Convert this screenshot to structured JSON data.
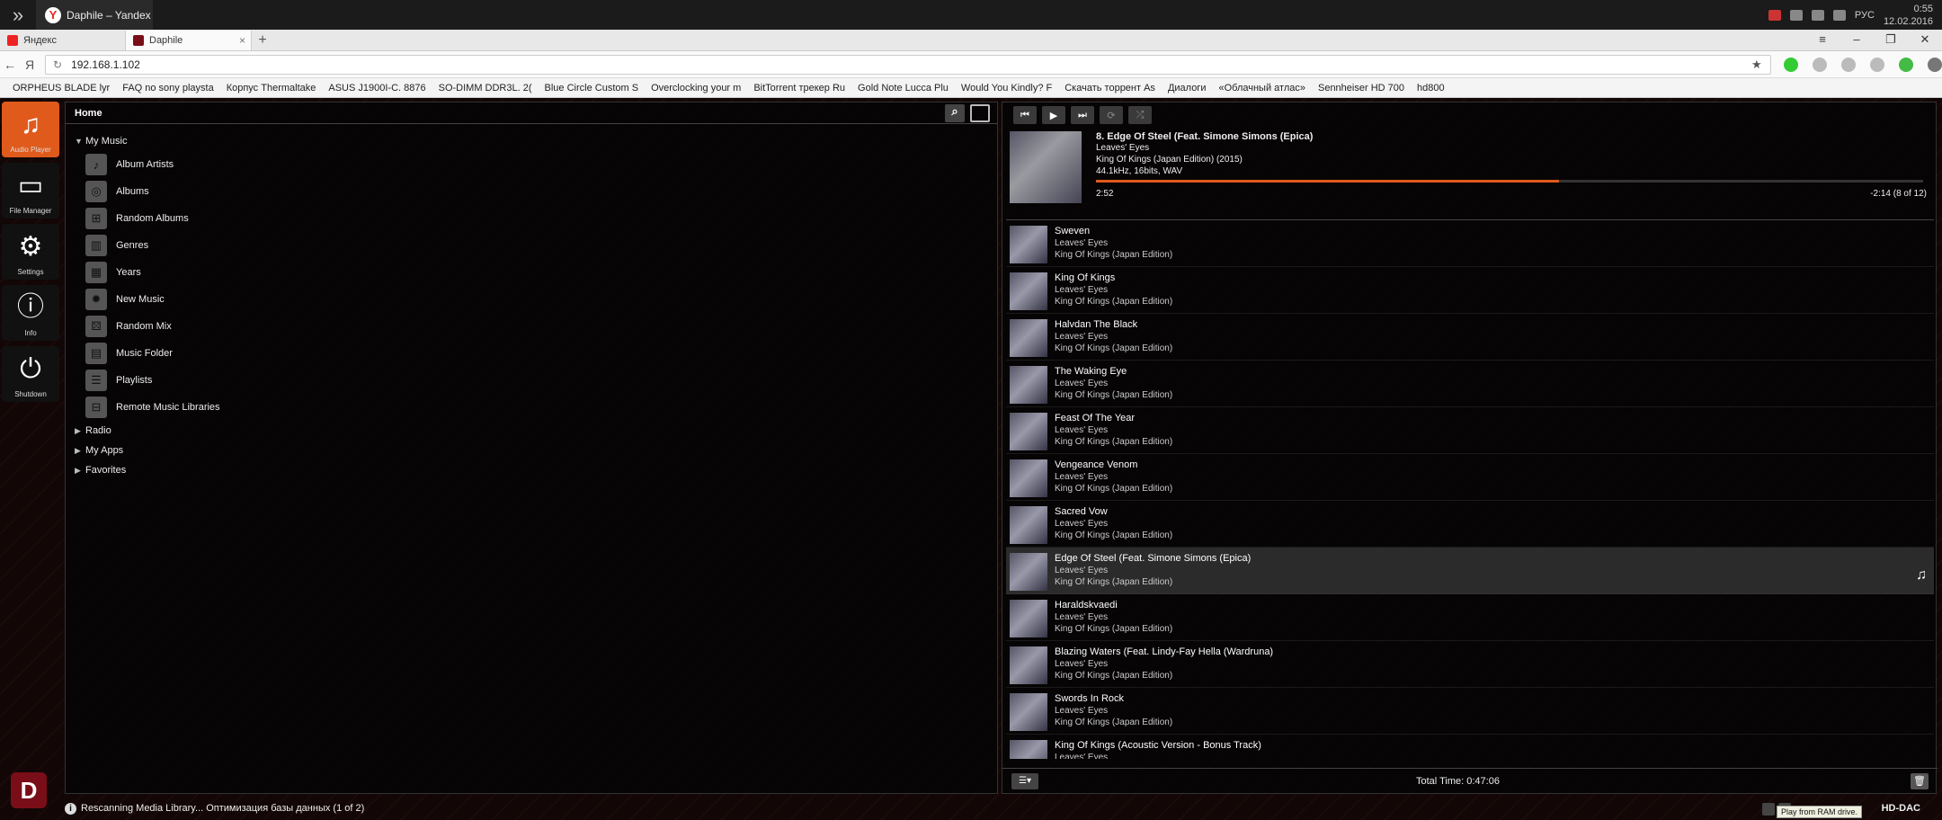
{
  "window": {
    "tab_title": "Daphile – Yandex",
    "tray_lang": "РУС",
    "time": "0:55",
    "date": "12.02.2016"
  },
  "browser": {
    "tabs": [
      {
        "label": "Яндекс",
        "active": false
      },
      {
        "label": "Daphile",
        "active": true
      }
    ],
    "new_tab": "+",
    "url": "192.168.1.102",
    "yandex_btn": "Я",
    "bookmarks": [
      "ORPHEUS BLADE lyr",
      "FAQ no sony playsta",
      "Корпус Thermaltake",
      "ASUS J1900I-C. 8876",
      "SO-DIMM DDR3L. 2(",
      "Blue Circle Custom S",
      "Overclocking your m",
      "BitTorrent трекер Ru",
      "Gold Note Lucca Plu",
      "Would You Kindly? F",
      "Скачать торрент As",
      "Диалоги",
      "«Облачный атлас»",
      "Sennheiser HD 700",
      "hd800"
    ]
  },
  "sidebar": {
    "items": [
      {
        "label": "Audio Player",
        "icon": "music-note-icon",
        "glyph": "♫",
        "active": true
      },
      {
        "label": "File Manager",
        "icon": "drive-icon",
        "glyph": "▭",
        "active": false
      },
      {
        "label": "Settings",
        "icon": "gear-icon",
        "glyph": "⚙",
        "active": false
      },
      {
        "label": "Info",
        "icon": "info-icon",
        "glyph": "ⓘ",
        "active": false
      },
      {
        "label": "Shutdown",
        "icon": "power-icon",
        "glyph": "⏻",
        "active": false
      }
    ],
    "logo": "D"
  },
  "library": {
    "header": "Home",
    "my_music": "My Music",
    "items": [
      {
        "label": "Album Artists",
        "icon": "artist-icon",
        "glyph": "♪"
      },
      {
        "label": "Albums",
        "icon": "album-icon",
        "glyph": "◎"
      },
      {
        "label": "Random Albums",
        "icon": "random-album-icon",
        "glyph": "⊞"
      },
      {
        "label": "Genres",
        "icon": "genre-icon",
        "glyph": "▥"
      },
      {
        "label": "Years",
        "icon": "calendar-icon",
        "glyph": "▦"
      },
      {
        "label": "New Music",
        "icon": "new-music-icon",
        "glyph": "✹"
      },
      {
        "label": "Random Mix",
        "icon": "dice-icon",
        "glyph": "⚄"
      },
      {
        "label": "Music Folder",
        "icon": "folder-icon",
        "glyph": "▤"
      },
      {
        "label": "Playlists",
        "icon": "playlist-icon",
        "glyph": "☰"
      },
      {
        "label": "Remote Music Libraries",
        "icon": "remote-library-icon",
        "glyph": "⊟"
      }
    ],
    "collapsed": [
      "Radio",
      "My Apps",
      "Favorites"
    ]
  },
  "status": {
    "text": "Rescanning Media Library... Оптимизация базы данных  (1 of 2)"
  },
  "player": {
    "now_playing": {
      "title": "8. Edge Of Steel (Feat. Simone Simons (Epica)",
      "artist": "Leaves' Eyes",
      "album": "King Of Kings (Japan Edition) (2015)",
      "format": "44.1kHz, 16bits, WAV",
      "elapsed": "2:52",
      "remaining": "-2:14  (8 of 12)",
      "progress": 0.56
    },
    "queue": [
      {
        "title": "Sweven",
        "artist": "Leaves' Eyes",
        "album": "King Of Kings (Japan Edition)"
      },
      {
        "title": "King Of Kings",
        "artist": "Leaves' Eyes",
        "album": "King Of Kings (Japan Edition)"
      },
      {
        "title": "Halvdan The Black",
        "artist": "Leaves' Eyes",
        "album": "King Of Kings (Japan Edition)"
      },
      {
        "title": "The Waking Eye",
        "artist": "Leaves' Eyes",
        "album": "King Of Kings (Japan Edition)"
      },
      {
        "title": "Feast Of The Year",
        "artist": "Leaves' Eyes",
        "album": "King Of Kings (Japan Edition)"
      },
      {
        "title": "Vengeance Venom",
        "artist": "Leaves' Eyes",
        "album": "King Of Kings (Japan Edition)"
      },
      {
        "title": "Sacred Vow",
        "artist": "Leaves' Eyes",
        "album": "King Of Kings (Japan Edition)"
      },
      {
        "title": "Edge Of Steel (Feat. Simone Simons (Epica)",
        "artist": "Leaves' Eyes",
        "album": "King Of Kings (Japan Edition)",
        "current": true
      },
      {
        "title": "Haraldskvaedi",
        "artist": "Leaves' Eyes",
        "album": "King Of Kings (Japan Edition)"
      },
      {
        "title": "Blazing Waters (Feat. Lindy-Fay Hella (Wardruna)",
        "artist": "Leaves' Eyes",
        "album": "King Of Kings (Japan Edition)"
      },
      {
        "title": "Swords In Rock",
        "artist": "Leaves' Eyes",
        "album": "King Of Kings (Japan Edition)"
      },
      {
        "title": "King Of Kings (Acoustic Version - Bonus Track)",
        "artist": "Leaves' Eyes",
        "album": ""
      }
    ],
    "total_time": "Total Time: 0:47:06",
    "output_device": "HD-DAC",
    "tooltip": "Play from RAM drive."
  },
  "colors": {
    "accent": "#e05a1c",
    "logo_red": "#7a0e18"
  }
}
